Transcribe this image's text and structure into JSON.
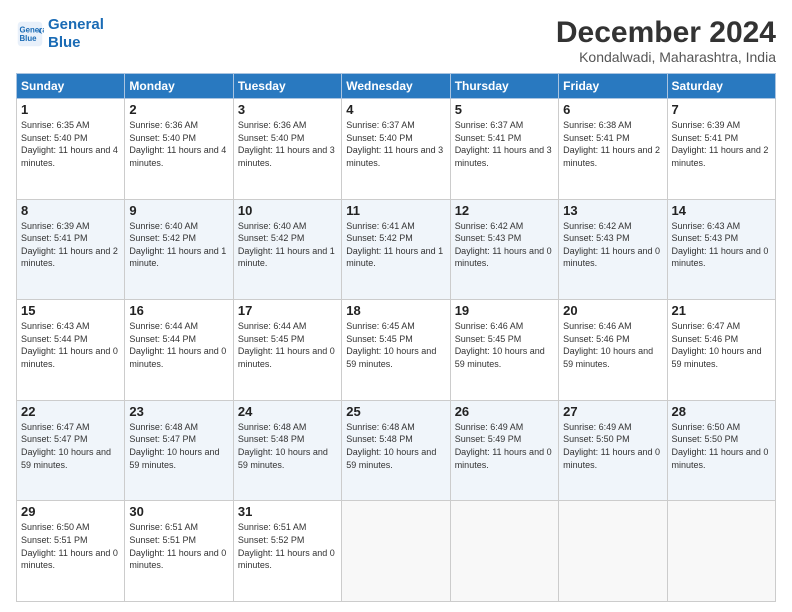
{
  "header": {
    "logo_line1": "General",
    "logo_line2": "Blue",
    "title": "December 2024",
    "subtitle": "Kondalwadi, Maharashtra, India"
  },
  "days_of_week": [
    "Sunday",
    "Monday",
    "Tuesday",
    "Wednesday",
    "Thursday",
    "Friday",
    "Saturday"
  ],
  "weeks": [
    [
      {
        "day": "1",
        "sunrise": "6:35 AM",
        "sunset": "5:40 PM",
        "daylight": "11 hours and 4 minutes."
      },
      {
        "day": "2",
        "sunrise": "6:36 AM",
        "sunset": "5:40 PM",
        "daylight": "11 hours and 4 minutes."
      },
      {
        "day": "3",
        "sunrise": "6:36 AM",
        "sunset": "5:40 PM",
        "daylight": "11 hours and 3 minutes."
      },
      {
        "day": "4",
        "sunrise": "6:37 AM",
        "sunset": "5:40 PM",
        "daylight": "11 hours and 3 minutes."
      },
      {
        "day": "5",
        "sunrise": "6:37 AM",
        "sunset": "5:41 PM",
        "daylight": "11 hours and 3 minutes."
      },
      {
        "day": "6",
        "sunrise": "6:38 AM",
        "sunset": "5:41 PM",
        "daylight": "11 hours and 2 minutes."
      },
      {
        "day": "7",
        "sunrise": "6:39 AM",
        "sunset": "5:41 PM",
        "daylight": "11 hours and 2 minutes."
      }
    ],
    [
      {
        "day": "8",
        "sunrise": "6:39 AM",
        "sunset": "5:41 PM",
        "daylight": "11 hours and 2 minutes."
      },
      {
        "day": "9",
        "sunrise": "6:40 AM",
        "sunset": "5:42 PM",
        "daylight": "11 hours and 1 minute."
      },
      {
        "day": "10",
        "sunrise": "6:40 AM",
        "sunset": "5:42 PM",
        "daylight": "11 hours and 1 minute."
      },
      {
        "day": "11",
        "sunrise": "6:41 AM",
        "sunset": "5:42 PM",
        "daylight": "11 hours and 1 minute."
      },
      {
        "day": "12",
        "sunrise": "6:42 AM",
        "sunset": "5:43 PM",
        "daylight": "11 hours and 0 minutes."
      },
      {
        "day": "13",
        "sunrise": "6:42 AM",
        "sunset": "5:43 PM",
        "daylight": "11 hours and 0 minutes."
      },
      {
        "day": "14",
        "sunrise": "6:43 AM",
        "sunset": "5:43 PM",
        "daylight": "11 hours and 0 minutes."
      }
    ],
    [
      {
        "day": "15",
        "sunrise": "6:43 AM",
        "sunset": "5:44 PM",
        "daylight": "11 hours and 0 minutes."
      },
      {
        "day": "16",
        "sunrise": "6:44 AM",
        "sunset": "5:44 PM",
        "daylight": "11 hours and 0 minutes."
      },
      {
        "day": "17",
        "sunrise": "6:44 AM",
        "sunset": "5:45 PM",
        "daylight": "11 hours and 0 minutes."
      },
      {
        "day": "18",
        "sunrise": "6:45 AM",
        "sunset": "5:45 PM",
        "daylight": "10 hours and 59 minutes."
      },
      {
        "day": "19",
        "sunrise": "6:46 AM",
        "sunset": "5:45 PM",
        "daylight": "10 hours and 59 minutes."
      },
      {
        "day": "20",
        "sunrise": "6:46 AM",
        "sunset": "5:46 PM",
        "daylight": "10 hours and 59 minutes."
      },
      {
        "day": "21",
        "sunrise": "6:47 AM",
        "sunset": "5:46 PM",
        "daylight": "10 hours and 59 minutes."
      }
    ],
    [
      {
        "day": "22",
        "sunrise": "6:47 AM",
        "sunset": "5:47 PM",
        "daylight": "10 hours and 59 minutes."
      },
      {
        "day": "23",
        "sunrise": "6:48 AM",
        "sunset": "5:47 PM",
        "daylight": "10 hours and 59 minutes."
      },
      {
        "day": "24",
        "sunrise": "6:48 AM",
        "sunset": "5:48 PM",
        "daylight": "10 hours and 59 minutes."
      },
      {
        "day": "25",
        "sunrise": "6:48 AM",
        "sunset": "5:48 PM",
        "daylight": "10 hours and 59 minutes."
      },
      {
        "day": "26",
        "sunrise": "6:49 AM",
        "sunset": "5:49 PM",
        "daylight": "11 hours and 0 minutes."
      },
      {
        "day": "27",
        "sunrise": "6:49 AM",
        "sunset": "5:50 PM",
        "daylight": "11 hours and 0 minutes."
      },
      {
        "day": "28",
        "sunrise": "6:50 AM",
        "sunset": "5:50 PM",
        "daylight": "11 hours and 0 minutes."
      }
    ],
    [
      {
        "day": "29",
        "sunrise": "6:50 AM",
        "sunset": "5:51 PM",
        "daylight": "11 hours and 0 minutes."
      },
      {
        "day": "30",
        "sunrise": "6:51 AM",
        "sunset": "5:51 PM",
        "daylight": "11 hours and 0 minutes."
      },
      {
        "day": "31",
        "sunrise": "6:51 AM",
        "sunset": "5:52 PM",
        "daylight": "11 hours and 0 minutes."
      },
      null,
      null,
      null,
      null
    ]
  ]
}
